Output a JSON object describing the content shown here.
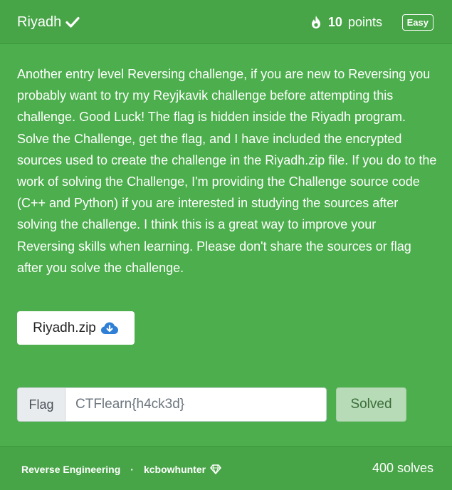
{
  "challenge": {
    "title": "Riyadh",
    "points_value": "10",
    "points_label": "points",
    "difficulty": "Easy",
    "description": "Another entry level Reversing challenge, if you are new to Reversing you probably want to try my Reyjkavik challenge before attempting this challenge. Good Luck! The flag is hidden inside the Riyadh program. Solve the Challenge, get the flag, and I have included the encrypted sources used to create the challenge in the Riyadh.zip file. If you do to the work of solving the Challenge, I'm providing the Challenge source code (C++ and Python) if you are interested in studying the sources after solving the challenge. I think this is a great way to improve your Reversing skills when learning. Please don't share the sources or flag after you solve the challenge.",
    "download_label": "Riyadh.zip"
  },
  "flag_form": {
    "label": "Flag",
    "value": "CTFlearn{h4ck3d}",
    "submit_label": "Solved"
  },
  "footer": {
    "category": "Reverse Engineering",
    "separator": "·",
    "author": "kcbowhunter",
    "solves": "400 solves"
  },
  "icons": {
    "title_status": "check-icon",
    "points": "fire-icon",
    "download": "cloud-download-icon",
    "author_badge": "gem-icon"
  },
  "colors": {
    "card_background": "#4cae4c",
    "header_footer_background": "#47a447",
    "download_icon": "#2f7fd6",
    "solved_button": "#b6dbb6"
  }
}
